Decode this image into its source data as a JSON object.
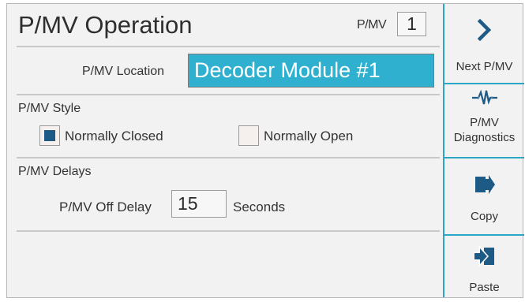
{
  "header": {
    "title": "P/MV Operation",
    "pmv_label": "P/MV",
    "pmv_number": "1"
  },
  "location": {
    "label": "P/MV Location",
    "value": "Decoder Module #1"
  },
  "style": {
    "section_label": "P/MV Style",
    "options": [
      {
        "label": "Normally Closed",
        "checked": true
      },
      {
        "label": "Normally Open",
        "checked": false
      }
    ]
  },
  "delays": {
    "section_label": "P/MV Delays",
    "off_delay_label": "P/MV Off Delay",
    "off_delay_value": "15",
    "unit": "Seconds"
  },
  "side_buttons": {
    "next": {
      "label": "Next P/MV",
      "icon": "chevron-right-icon"
    },
    "diagnostics": {
      "label_line1": "P/MV",
      "label_line2": "Diagnostics",
      "icon": "pulse-icon"
    },
    "copy": {
      "label": "Copy",
      "icon": "copy-export-icon"
    },
    "paste": {
      "label": "Paste",
      "icon": "paste-import-icon"
    }
  },
  "colors": {
    "accent": "#2fb0cf",
    "divider": "#2aa6c6",
    "checkbox_fill": "#1d5a85",
    "icon_color": "#1d5a85",
    "background": "#f2f2f2"
  }
}
